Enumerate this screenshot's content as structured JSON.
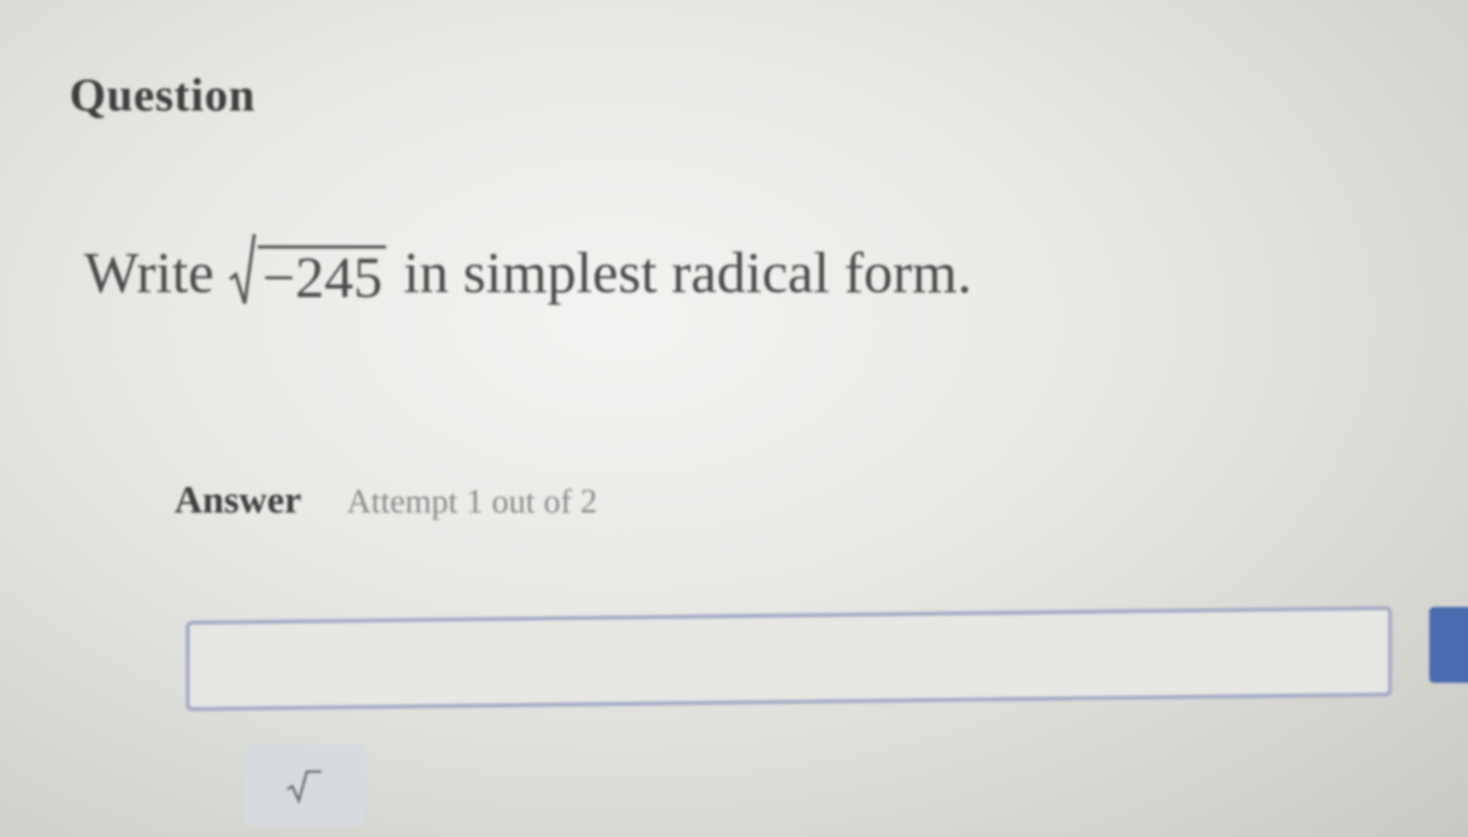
{
  "question": {
    "heading": "Question",
    "prompt_before": "Write",
    "radicand": "−245",
    "prompt_after": "in simplest radical form."
  },
  "answer": {
    "label": "Answer",
    "attempt_text": "Attempt 1 out of 2",
    "input_value": ""
  },
  "toolbar": {
    "sqrt_button_icon": "square-root-icon"
  },
  "colors": {
    "input_border": "#a6acc6",
    "submit_button": "#4a6bb0"
  }
}
